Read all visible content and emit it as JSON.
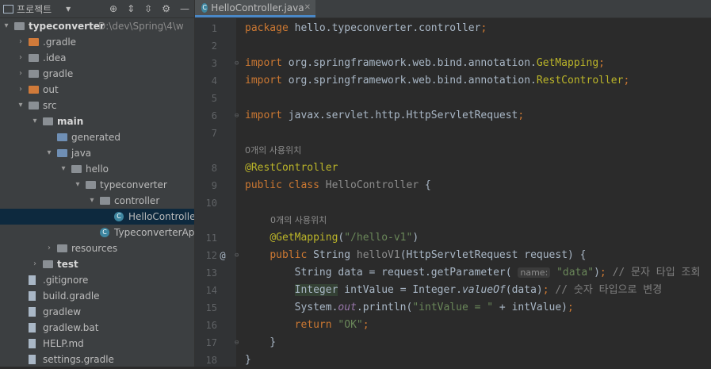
{
  "project_panel": {
    "title": "프로젝트",
    "tree": [
      {
        "label": "typeconverter",
        "path": "D:\\dev\\Spring\\4\\w",
        "bold": true,
        "arrow": "▾",
        "indent": 0,
        "icon": "folder"
      },
      {
        "label": ".gradle",
        "arrow": "›",
        "indent": 1,
        "icon": "folder-orange"
      },
      {
        "label": ".idea",
        "arrow": "›",
        "indent": 1,
        "icon": "folder"
      },
      {
        "label": "gradle",
        "arrow": "›",
        "indent": 1,
        "icon": "folder"
      },
      {
        "label": "out",
        "arrow": "›",
        "indent": 1,
        "icon": "folder-orange"
      },
      {
        "label": "src",
        "arrow": "▾",
        "indent": 1,
        "icon": "folder"
      },
      {
        "label": "main",
        "arrow": "▾",
        "indent": 2,
        "icon": "folder",
        "bold": true
      },
      {
        "label": "generated",
        "arrow": "",
        "indent": 3,
        "icon": "folder-blue"
      },
      {
        "label": "java",
        "arrow": "▾",
        "indent": 3,
        "icon": "folder-blue"
      },
      {
        "label": "hello",
        "arrow": "▾",
        "indent": 4,
        "icon": "package"
      },
      {
        "label": "typeconverter",
        "arrow": "▾",
        "indent": 5,
        "icon": "package"
      },
      {
        "label": "controller",
        "arrow": "▾",
        "indent": 6,
        "icon": "package"
      },
      {
        "label": "HelloController",
        "arrow": "",
        "indent": 7,
        "icon": "class",
        "selected": true
      },
      {
        "label": "TypeconverterApp",
        "arrow": "",
        "indent": 6,
        "icon": "class"
      },
      {
        "label": "resources",
        "arrow": "›",
        "indent": 3,
        "icon": "folder"
      },
      {
        "label": "test",
        "arrow": "›",
        "indent": 2,
        "icon": "folder",
        "bold": true
      },
      {
        "label": ".gitignore",
        "arrow": "",
        "indent": 1,
        "icon": "file"
      },
      {
        "label": "build.gradle",
        "arrow": "",
        "indent": 1,
        "icon": "gradle"
      },
      {
        "label": "gradlew",
        "arrow": "",
        "indent": 1,
        "icon": "file"
      },
      {
        "label": "gradlew.bat",
        "arrow": "",
        "indent": 1,
        "icon": "file"
      },
      {
        "label": "HELP.md",
        "arrow": "",
        "indent": 1,
        "icon": "md"
      },
      {
        "label": "settings.gradle",
        "arrow": "",
        "indent": 1,
        "icon": "gradle"
      }
    ]
  },
  "editor": {
    "tab_label": "HelloController.java",
    "usage_hint": "0개의 사용위치",
    "lines": [
      {
        "n": "1",
        "html": "<span class='k'>package</span> hello.typeconverter.controller<span class='k'>;</span>"
      },
      {
        "n": "2",
        "html": ""
      },
      {
        "n": "3",
        "html": "<span class='k'>import</span> org.springframework.web.bind.annotation.<span class='a'>GetMapping</span><span class='k'>;</span>",
        "fold": "⊖"
      },
      {
        "n": "4",
        "html": "<span class='k'>import</span> org.springframework.web.bind.annotation.<span class='a'>RestController</span><span class='k'>;</span>"
      },
      {
        "n": "5",
        "html": ""
      },
      {
        "n": "6",
        "html": "<span class='k'>import</span> javax.servlet.http.HttpServletRequest<span class='k'>;</span>",
        "fold": "⊖"
      },
      {
        "n": "7",
        "html": ""
      },
      {
        "n": "",
        "hint": true,
        "indent": 0
      },
      {
        "n": "8",
        "html": "<span class='a'>@RestController</span>"
      },
      {
        "n": "9",
        "html": "<span class='k'>public class</span> <span class='gray'>HelloController</span> {"
      },
      {
        "n": "10",
        "html": ""
      },
      {
        "n": "",
        "hint": true,
        "indent": 4
      },
      {
        "n": "11",
        "html": "    <span class='a'>@GetMapping</span>(<span class='s'>\"/hello-v1\"</span>)"
      },
      {
        "n": "12",
        "html": "    <span class='k'>public</span> String <span class='gray'>helloV1</span>(HttpServletRequest request) {",
        "mark": "@",
        "fold": "⊖"
      },
      {
        "n": "13",
        "html": "        String data = request.getParameter( <span class='inlay'>name:</span> <span class='s'>\"data\"</span>)<span class='k'>;</span> <span class='c'>// 문자 타입 조회</span>"
      },
      {
        "n": "14",
        "html": "        <span class='hl'>Integer</span> intValue = Integer.<span class='it'>valueOf</span>(data)<span class='k'>;</span> <span class='c'>// 숫자 타입으로 변경</span>"
      },
      {
        "n": "15",
        "html": "        System.<span class='field'>out</span>.println(<span class='s'>\"intValue = \"</span> + intValue)<span class='k'>;</span>"
      },
      {
        "n": "16",
        "html": "        <span class='k'>return</span> <span class='s'>\"OK\"</span><span class='k'>;</span>"
      },
      {
        "n": "17",
        "html": "    }",
        "fold": "⊖"
      },
      {
        "n": "18",
        "html": "}"
      }
    ]
  }
}
